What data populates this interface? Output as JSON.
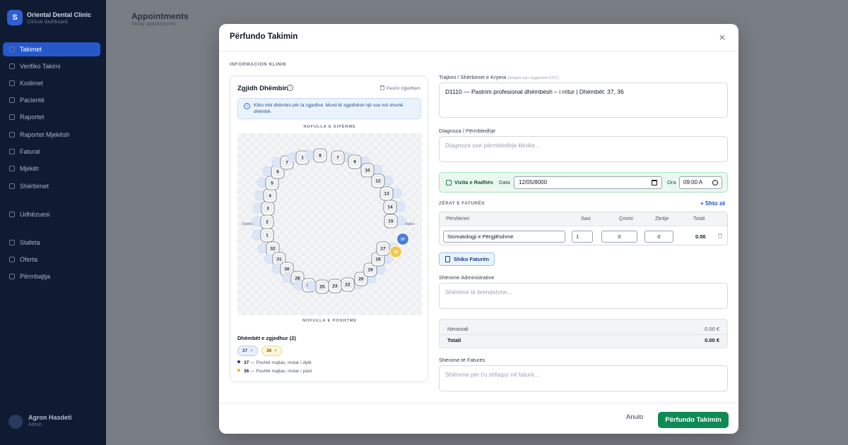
{
  "modal": {
    "title": "Përfundo Takimin",
    "close_symbol": "×",
    "section_label": "INFORMACION KLINIK",
    "cancel_label": "Anulo",
    "submit_label": "Përfundo Takimin"
  },
  "tooth_selector": {
    "title": "Zgjidh Dhëmbin",
    "info_symbol": "i",
    "clear_label": "Pastro zgjedhjen",
    "info_text": "Kliko mbi dhëmbin për ta zgjedhur. Mund të zgjedhësh një ose më shumë dhëmbë.",
    "upper_jaw_label": "NOFULLA E SIPËRME",
    "lower_jaw_label": "NOFULLA E POSHTME",
    "side_left": "Djathtas",
    "side_right": "Majtas",
    "selected_title": "Dhëmbët e zgjedhur (2)",
    "chips": [
      {
        "tooth": "37",
        "remove": "×"
      },
      {
        "tooth": "36",
        "remove": "×"
      }
    ],
    "legend": [
      {
        "tooth": "37",
        "text": " — Poshtë majtas, molar i dytë"
      },
      {
        "tooth": "36",
        "text": " — Poshtë majtas, molar i parë"
      }
    ],
    "upper_teeth": [
      "1",
      "2",
      "3",
      "4",
      "5",
      "6",
      "7",
      "1",
      "8",
      "7",
      "9",
      "10",
      "12",
      "13",
      "14",
      "15"
    ],
    "lower_teeth": [
      "32",
      "31",
      "30",
      "28",
      "27",
      "25",
      "23",
      "22",
      "20",
      "19",
      "18",
      "17"
    ],
    "selected_teeth": [
      "37",
      "36"
    ],
    "colors": {
      "selected_primary": "#4a7fd6",
      "selected_secondary": "#f3c84a"
    }
  },
  "treatment": {
    "label": "Trajtimi / Shërbimet e Kryera",
    "hint": "(shtypni për sugjerime CDT)",
    "value": "D1110 — Pastrim profesional dhëmbësh – i rritur | Dhëmbët: 37, 36"
  },
  "diagnosis": {
    "label": "Diagnoza / Përmbledhje",
    "placeholder": "Diagnoza ose përmbledhje klinike..."
  },
  "next_visit": {
    "label": "Vizita e Radhës",
    "date_label": "Data",
    "date_value": "12/05/8000",
    "time_label": "Ora",
    "time_value": "09:00 A"
  },
  "invoice_items": {
    "section_label": "ZËRAT E FATURËS",
    "add_label": "+ Shto zë",
    "columns": [
      "Përshkrimi",
      "Sasi",
      "Çmimi",
      "Zbritje",
      "Totali"
    ],
    "rows": [
      {
        "description": "Stomatologji e Përgjithshme",
        "qty": "1",
        "price": "0",
        "discount": "0",
        "total": "0.00"
      }
    ],
    "view_invoice_label": "Shiko Faturën"
  },
  "admin_notes": {
    "label": "Shënime Administrative",
    "placeholder": "Shënime të brendshme..."
  },
  "totals": {
    "subtotal_label": "Nëntotali",
    "subtotal_value": "0.00 €",
    "total_label": "Totali",
    "total_value": "0.00 €"
  },
  "invoice_notes": {
    "label": "Shënime të Faturës",
    "placeholder": "Shënime për t'u shfaqur në faturë..."
  },
  "background": {
    "app_name": "Oriental Dental Clinic",
    "app_sub": "Clinical dashboard",
    "page_title": "Appointments",
    "page_subtitle": "Today appointments",
    "sidebar_items": [
      "Takimet",
      "Verifiko Takimi",
      "Kodimet",
      "Pacientë",
      "Raportet",
      "Raportet Mjekësh",
      "Faturat",
      "Mjekët",
      "Shërbimet",
      "Udhëzuesi",
      "Stafeta",
      "Oferta",
      "Përmbajtja"
    ],
    "user_name": "Agron Hasdeti",
    "user_role": "Admin"
  }
}
